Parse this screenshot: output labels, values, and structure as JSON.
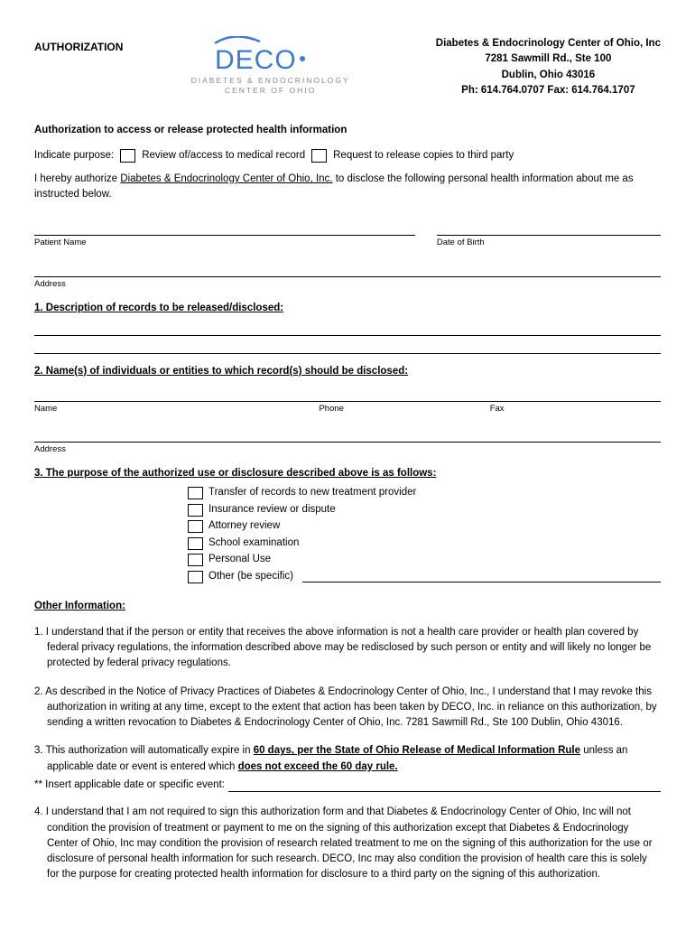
{
  "header": {
    "left": "AUTHORIZATION",
    "logo_sub1": "DIABETES & ENDOCRINOLOGY",
    "logo_sub2": "CENTER OF OHIO",
    "org_name": "Diabetes & Endocrinology Center of Ohio, Inc",
    "addr1": "7281 Sawmill Rd., Ste 100",
    "addr2": "Dublin, Ohio 43016",
    "phones": "Ph: 614.764.0707  Fax: 614.764.1707"
  },
  "title": "Authorization to access or release protected health information",
  "purpose": {
    "label": "Indicate purpose:",
    "opt1": "Review of/access to medical record",
    "opt2": "Request to release copies to third party"
  },
  "auth_text_pre": "I hereby authorize ",
  "auth_text_org": "Diabetes & Endocrinology Center of Ohio, Inc.",
  "auth_text_post": " to disclose the following personal health information about me as instructed below.",
  "fields": {
    "patient_name": "Patient Name",
    "dob": "Date of Birth",
    "address": "Address",
    "name": "Name",
    "phone": "Phone",
    "fax": "Fax"
  },
  "sections": {
    "s1": "1.  Description of records to be released/disclosed:",
    "s2": "2.  Name(s) of individuals or entities to which record(s) should be disclosed:",
    "s3": "3.  The purpose of the authorized use or disclosure described above is as follows:"
  },
  "purposes": {
    "p1": "Transfer of records to new treatment provider",
    "p2": "Insurance review or dispute",
    "p3": "Attorney review",
    "p4": "School examination",
    "p5": "Personal Use",
    "p6": "Other (be specific)"
  },
  "other_info_title": "Other Information:",
  "info": {
    "i1": "1.  I understand that if the person or entity that receives the above information is not a health care provider or health plan covered by federal privacy regulations, the information described above may be redisclosed by such person or entity and will likely no longer be protected by federal privacy regulations.",
    "i2": "2.  As described in the Notice of Privacy Practices of Diabetes & Endocrinology Center of Ohio, Inc., I understand that I may revoke this authorization in writing at any time, except to the extent that action has been taken by DECO, Inc. in reliance on this authorization, by sending a written revocation to Diabetes & Endocrinology Center of Ohio, Inc. 7281 Sawmill Rd., Ste 100 Dublin, Ohio 43016.",
    "i3_pre": "3.  This authorization will automatically expire in ",
    "i3_bold1": "60 days, per the State of Ohio Release of Medical Information Rule",
    "i3_mid": " unless an applicable date or event is entered which ",
    "i3_bold2": "does not exceed the 60 day rule.",
    "i3_insert": "** Insert applicable date or specific event:",
    "i4": "4.  I understand that I am not required to sign this authorization form and that Diabetes & Endocrinology Center of Ohio, Inc will not condition the provision of treatment or payment to me on the signing of this authorization except that Diabetes & Endocrinology Center of Ohio, Inc may condition the provision of research related treatment to me on the signing of this authorization for the use or disclosure of personal health information for such research.  DECO, Inc may also condition the provision of health care this is solely for the purpose for creating protected health information for disclosure to a third party on the signing of this authorization."
  }
}
